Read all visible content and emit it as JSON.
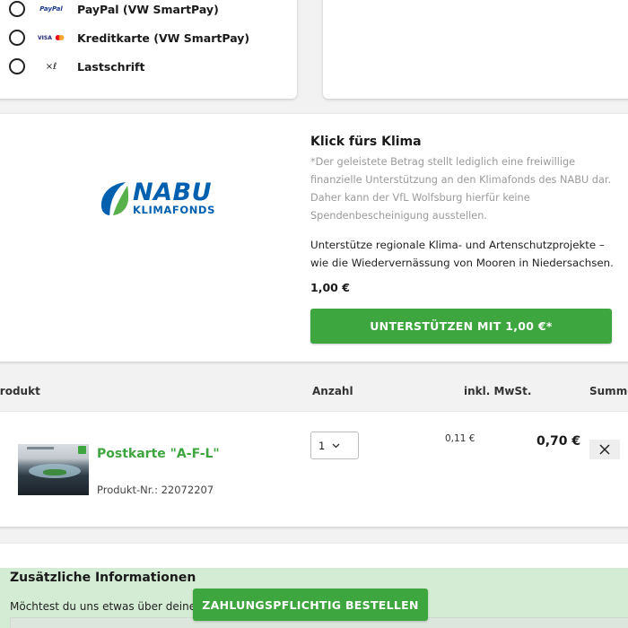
{
  "payment": {
    "options": [
      {
        "label": "PayPal (VW SmartPay)",
        "icon": "paypal-logo",
        "logo_text": "PayPal"
      },
      {
        "label": "Kreditkarte (VW SmartPay)",
        "icon": "visa-mastercard-logo",
        "logo_text": "VISA"
      },
      {
        "label": "Lastschrift",
        "icon": "signature-icon",
        "logo_text": "×ℓ"
      }
    ]
  },
  "klima": {
    "logo_big": "NABU",
    "logo_small": "KLIMAFONDS",
    "title": "Klick fürs Klima",
    "note": "*Der geleistete Betrag stellt lediglich eine freiwillige finanzielle Unterstützung an den Klimafonds des NABU dar. Daher kann der VfL Wolfsburg hierfür keine Spendenbescheinigung ausstellen.",
    "description": "Unterstütze regionale Klima- und Artenschutzprojekte – wie die Wiedervernässung von Mooren in Niedersachsen.",
    "amount": "1,00 €",
    "button": "UNTERSTÜTZEN MIT 1,00 €*"
  },
  "table": {
    "headers": {
      "product": "Produkt",
      "quantity": "Anzahl",
      "vat": "inkl. MwSt.",
      "sum": "Summe"
    }
  },
  "product": {
    "name": "Postkarte \"A-F-L\"",
    "number": "Produkt-Nr.: 22072207",
    "quantity": "1",
    "vat": "0,11 €",
    "price": "0,70 €"
  },
  "extra": {
    "title": "Zusätzliche Informationen",
    "question": "Möchtest du uns etwas über deine Bestellung mitteilen?"
  },
  "order": {
    "button": "ZAHLUNGSPFLICHTIG BESTELLEN"
  },
  "colors": {
    "accent": "#3ea63e",
    "nabu_blue": "#0060b0",
    "band": "#d4ebd4"
  }
}
